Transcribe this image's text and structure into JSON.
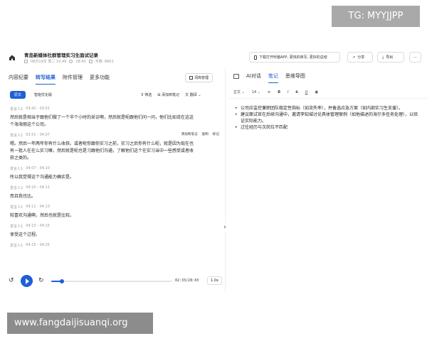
{
  "watermarks": {
    "top": "TG: MYYJJPP",
    "bottom": "www.fangdaijisuanqi.org"
  },
  "header": {
    "title": "青岛新媒体社群管理实习生面试记录",
    "date": "08月19日 周二 10:49",
    "duration": "28:43",
    "words": "字数: 8601",
    "download_app": "下载打开听脑APP, 更快的转写, 更好的总结",
    "share": "分享",
    "export": "导出",
    "more": "···"
  },
  "left": {
    "tabs": [
      "内容纪要",
      "转写结果",
      "附件管理",
      "更多功能"
    ],
    "active_tab": 1,
    "vocab_button": "词库管理",
    "subtabs": [
      "原文",
      "智能优化版"
    ],
    "tools": {
      "filter": "筛选",
      "add_note": "添加到笔记",
      "translate": "翻译"
    },
    "segment_actions": {
      "add_note": "添加到笔记",
      "copy": "复制",
      "mark": "标记"
    },
    "segments": [
      {
        "speaker": "发言人1",
        "time": "03:42 - 03:51",
        "lines": [
          "然后就是相当于跟他们做了一个半个小时的采访啊，然后就是呃跟他们问一问，他们比如说在这这",
          "个海海丽这个公司。"
        ]
      },
      {
        "speaker": "发言人1",
        "time": "03:51 - 04:07",
        "lines": [
          "嗯。然后一年两年你有什么收获。或者呢你跟你实习之前，实习之后你有什么呃，就是因为现在也",
          "有一批人在在么实习嘛，然后就是呃也是习跟他们沟通，了解他们这个在实习当中一些感受或者收",
          "获之类的。"
        ]
      },
      {
        "speaker": "发言人1",
        "time": "04:07 - 04:10",
        "lines": [
          "所以我觉得这个沟通能力确实是。"
        ]
      },
      {
        "speaker": "发言人2",
        "time": "04:10 - 04:11",
        "lines": [
          "而且我也比。"
        ]
      },
      {
        "speaker": "发言人1",
        "time": "04:11 - 04:13",
        "lines": [
          "较喜欢沟通啊，然后也就是比较。"
        ]
      },
      {
        "speaker": "发言人1",
        "time": "04:13 - 04:15",
        "lines": [
          "享受这个过程。"
        ]
      },
      {
        "speaker": "发言人1",
        "time": "04:15 - 04:25",
        "lines": []
      }
    ],
    "player": {
      "time": "02:33/28:43",
      "speed": "1.0x",
      "progress": 0.089
    }
  },
  "right": {
    "tabs": [
      "AI对话",
      "笔记",
      "思维导图"
    ],
    "active_tab": 1,
    "toolbar": {
      "text_style": "正文",
      "font_size": "14",
      "bold": "B",
      "italic": "I",
      "strike": "S",
      "underline": "U"
    },
    "notes": [
      "公司应监控兼职团队稳定性指标（如流失率），并备选应急方案（如内部实习生支援）。",
      "建议面试官在后续沟通中，邀请李知城讨论具体管理案例（如他描述的海尔多任务处理），以验证实际能力。",
      "过往经历与次岗位不匹配"
    ]
  },
  "colors": {
    "accent": "#1f5fd6"
  }
}
